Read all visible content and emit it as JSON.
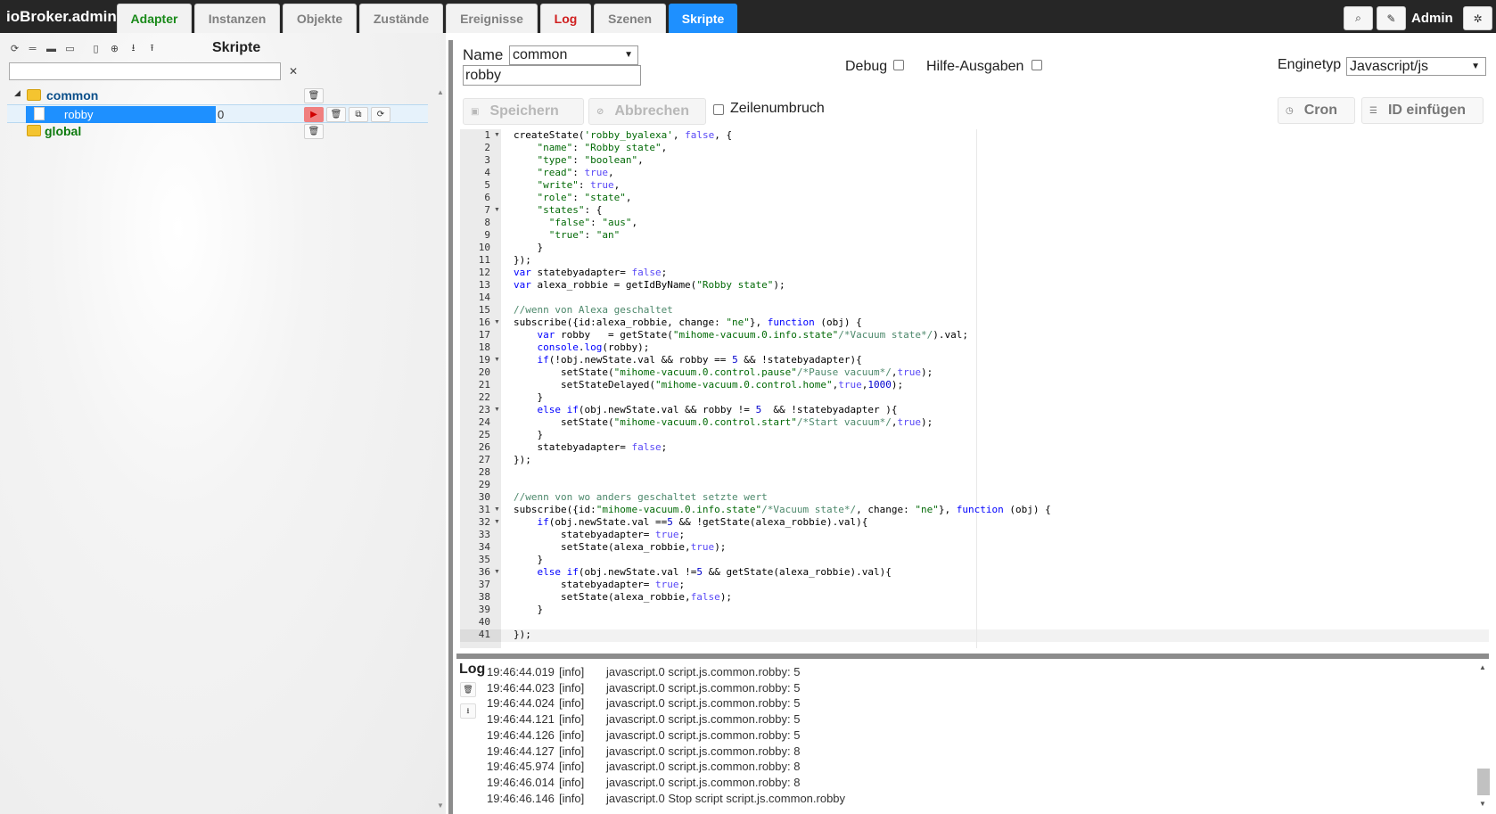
{
  "app": {
    "title": "ioBroker.admin"
  },
  "tabs": [
    {
      "label": "Adapter"
    },
    {
      "label": "Instanzen"
    },
    {
      "label": "Objekte"
    },
    {
      "label": "Zustände"
    },
    {
      "label": "Ereignisse"
    },
    {
      "label": "Log"
    },
    {
      "label": "Szenen"
    },
    {
      "label": "Skripte"
    }
  ],
  "header": {
    "user": "Admin",
    "icons": [
      "search-icon",
      "edit-icon",
      "settings-icon"
    ]
  },
  "sidebar": {
    "title": "Skripte",
    "filter_value": "",
    "toolbar_icons": [
      "refresh-icon",
      "collapse-icon",
      "folder-icon",
      "folder-open-icon",
      "new-script-icon",
      "add-folder-icon",
      "export-icon",
      "import-icon"
    ],
    "tree": {
      "folders": [
        {
          "label": "common",
          "expanded": true
        },
        {
          "label": "global",
          "expanded": false
        }
      ],
      "scripts": [
        {
          "label": "robby",
          "count": "0",
          "status": "stopped"
        }
      ]
    }
  },
  "editor_header": {
    "name_label": "Name",
    "folder_select_value": "common",
    "name_value": "robby",
    "debug_label": "Debug",
    "debug_checked": false,
    "help_label": "Hilfe-Ausgaben",
    "help_checked": false,
    "engine_label": "Enginetyp",
    "engine_value": "Javascript/js"
  },
  "editor_toolbar": {
    "save_label": "Speichern",
    "cancel_label": "Abbrechen",
    "wrap_label": "Zeilenumbruch",
    "wrap_checked": false,
    "cron_label": "Cron",
    "insert_id_label": "ID einfügen"
  },
  "code": {
    "active_line": 41,
    "fold_lines": [
      1,
      7,
      16,
      19,
      23,
      31,
      32,
      36
    ],
    "lines": [
      [
        [
          "createState(",
          ""
        ],
        [
          "'robby_byalexa'",
          "str"
        ],
        [
          ", ",
          ""
        ],
        [
          "false",
          "bool"
        ],
        [
          ", {",
          ""
        ]
      ],
      [
        [
          "    ",
          ""
        ],
        [
          "\"name\"",
          "str"
        ],
        [
          ": ",
          ""
        ],
        [
          "\"Robby state\"",
          "str"
        ],
        [
          ",",
          ""
        ]
      ],
      [
        [
          "    ",
          ""
        ],
        [
          "\"type\"",
          "str"
        ],
        [
          ": ",
          ""
        ],
        [
          "\"boolean\"",
          "str"
        ],
        [
          ",",
          ""
        ]
      ],
      [
        [
          "    ",
          ""
        ],
        [
          "\"read\"",
          "str"
        ],
        [
          ": ",
          ""
        ],
        [
          "true",
          "bool"
        ],
        [
          ",",
          ""
        ]
      ],
      [
        [
          "    ",
          ""
        ],
        [
          "\"write\"",
          "str"
        ],
        [
          ": ",
          ""
        ],
        [
          "true",
          "bool"
        ],
        [
          ",",
          ""
        ]
      ],
      [
        [
          "    ",
          ""
        ],
        [
          "\"role\"",
          "str"
        ],
        [
          ": ",
          ""
        ],
        [
          "\"state\"",
          "str"
        ],
        [
          ",",
          ""
        ]
      ],
      [
        [
          "    ",
          ""
        ],
        [
          "\"states\"",
          "str"
        ],
        [
          ": {",
          ""
        ]
      ],
      [
        [
          "      ",
          ""
        ],
        [
          "\"false\"",
          "str"
        ],
        [
          ": ",
          ""
        ],
        [
          "\"aus\"",
          "str"
        ],
        [
          ",",
          ""
        ]
      ],
      [
        [
          "      ",
          ""
        ],
        [
          "\"true\"",
          "str"
        ],
        [
          ": ",
          ""
        ],
        [
          "\"an\"",
          "str"
        ]
      ],
      [
        [
          "    }",
          ""
        ]
      ],
      [
        [
          "});",
          ""
        ]
      ],
      [
        [
          "var",
          "kw"
        ],
        [
          " statebyadapter= ",
          ""
        ],
        [
          "false",
          "bool"
        ],
        [
          ";",
          ""
        ]
      ],
      [
        [
          "var",
          "kw"
        ],
        [
          " alexa_robbie = getIdByName(",
          ""
        ],
        [
          "\"Robby state\"",
          "str"
        ],
        [
          ");",
          ""
        ]
      ],
      [
        [
          "",
          ""
        ]
      ],
      [
        [
          "//wenn von Alexa geschaltet",
          "cm"
        ]
      ],
      [
        [
          "subscribe({id:alexa_robbie, change: ",
          ""
        ],
        [
          "\"ne\"",
          "str"
        ],
        [
          "}, ",
          ""
        ],
        [
          "function",
          "kw"
        ],
        [
          " (obj) {",
          ""
        ]
      ],
      [
        [
          "    ",
          ""
        ],
        [
          "var",
          "kw"
        ],
        [
          " robby   = getState(",
          ""
        ],
        [
          "\"mihome-vacuum.0.info.state\"",
          "str"
        ],
        [
          "/*Vacuum state*/",
          "cm"
        ],
        [
          ").val;",
          ""
        ]
      ],
      [
        [
          "    ",
          ""
        ],
        [
          "console",
          "kw"
        ],
        [
          ".",
          ""
        ],
        [
          "log",
          "kw"
        ],
        [
          "(robby);",
          ""
        ]
      ],
      [
        [
          "    ",
          ""
        ],
        [
          "if",
          "kw"
        ],
        [
          "(!obj.newState.val && robby == ",
          ""
        ],
        [
          "5",
          "num"
        ],
        [
          " && !statebyadapter){",
          ""
        ]
      ],
      [
        [
          "        setState(",
          ""
        ],
        [
          "\"mihome-vacuum.0.control.pause\"",
          "str"
        ],
        [
          "/*Pause vacuum*/",
          "cm"
        ],
        [
          ",",
          ""
        ],
        [
          "true",
          "bool"
        ],
        [
          ");",
          ""
        ]
      ],
      [
        [
          "        setStateDelayed(",
          ""
        ],
        [
          "\"mihome-vacuum.0.control.home\"",
          "str"
        ],
        [
          ",",
          ""
        ],
        [
          "true",
          "bool"
        ],
        [
          ",",
          ""
        ],
        [
          "1000",
          "num"
        ],
        [
          ");",
          ""
        ]
      ],
      [
        [
          "    }",
          ""
        ]
      ],
      [
        [
          "    ",
          ""
        ],
        [
          "else",
          "kw"
        ],
        [
          " ",
          ""
        ],
        [
          "if",
          "kw"
        ],
        [
          "(obj.newState.val && robby != ",
          ""
        ],
        [
          "5",
          "num"
        ],
        [
          "  && !statebyadapter ){",
          ""
        ]
      ],
      [
        [
          "        setState(",
          ""
        ],
        [
          "\"mihome-vacuum.0.control.start\"",
          "str"
        ],
        [
          "/*Start vacuum*/",
          "cm"
        ],
        [
          ",",
          ""
        ],
        [
          "true",
          "bool"
        ],
        [
          ");",
          ""
        ]
      ],
      [
        [
          "    }",
          ""
        ]
      ],
      [
        [
          "    statebyadapter= ",
          ""
        ],
        [
          "false",
          "bool"
        ],
        [
          ";",
          ""
        ]
      ],
      [
        [
          "});",
          ""
        ]
      ],
      [
        [
          "",
          ""
        ]
      ],
      [
        [
          "",
          ""
        ]
      ],
      [
        [
          "//wenn von wo anders geschaltet setzte wert",
          "cm"
        ]
      ],
      [
        [
          "subscribe({id:",
          ""
        ],
        [
          "\"mihome-vacuum.0.info.state\"",
          "str"
        ],
        [
          "/*Vacuum state*/",
          "cm"
        ],
        [
          ", change: ",
          ""
        ],
        [
          "\"ne\"",
          "str"
        ],
        [
          "}, ",
          ""
        ],
        [
          "function",
          "kw"
        ],
        [
          " (obj) {",
          ""
        ]
      ],
      [
        [
          "    ",
          ""
        ],
        [
          "if",
          "kw"
        ],
        [
          "(obj.newState.val ==",
          ""
        ],
        [
          "5",
          "num"
        ],
        [
          " && !getState(alexa_robbie).val){",
          ""
        ]
      ],
      [
        [
          "        statebyadapter= ",
          ""
        ],
        [
          "true",
          "bool"
        ],
        [
          ";",
          ""
        ]
      ],
      [
        [
          "        setState(alexa_robbie,",
          ""
        ],
        [
          "true",
          "bool"
        ],
        [
          ");",
          ""
        ]
      ],
      [
        [
          "    }",
          ""
        ]
      ],
      [
        [
          "    ",
          ""
        ],
        [
          "else",
          "kw"
        ],
        [
          " ",
          ""
        ],
        [
          "if",
          "kw"
        ],
        [
          "(obj.newState.val !=",
          ""
        ],
        [
          "5",
          "num"
        ],
        [
          " && getState(alexa_robbie).val){",
          ""
        ]
      ],
      [
        [
          "        statebyadapter= ",
          ""
        ],
        [
          "true",
          "bool"
        ],
        [
          ";",
          ""
        ]
      ],
      [
        [
          "        setState(alexa_robbie,",
          ""
        ],
        [
          "false",
          "bool"
        ],
        [
          ");",
          ""
        ]
      ],
      [
        [
          "    }",
          ""
        ]
      ],
      [
        [
          "",
          ""
        ]
      ],
      [
        [
          "});",
          ""
        ]
      ]
    ]
  },
  "log": {
    "title": "Log",
    "tool_icons": [
      "trash-icon",
      "download-icon"
    ],
    "entries": [
      {
        "time": "19:46:44.019",
        "level": "[info]",
        "message": "javascript.0 script.js.common.robby: 5"
      },
      {
        "time": "19:46:44.023",
        "level": "[info]",
        "message": "javascript.0 script.js.common.robby: 5"
      },
      {
        "time": "19:46:44.024",
        "level": "[info]",
        "message": "javascript.0 script.js.common.robby: 5"
      },
      {
        "time": "19:46:44.121",
        "level": "[info]",
        "message": "javascript.0 script.js.common.robby: 5"
      },
      {
        "time": "19:46:44.126",
        "level": "[info]",
        "message": "javascript.0 script.js.common.robby: 5"
      },
      {
        "time": "19:46:44.127",
        "level": "[info]",
        "message": "javascript.0 script.js.common.robby: 8"
      },
      {
        "time": "19:46:45.974",
        "level": "[info]",
        "message": "javascript.0 script.js.common.robby: 8"
      },
      {
        "time": "19:46:46.014",
        "level": "[info]",
        "message": "javascript.0 script.js.common.robby: 8"
      },
      {
        "time": "19:46:46.146",
        "level": "[info]",
        "message": "javascript.0 Stop script script.js.common.robby"
      }
    ]
  },
  "colors": {
    "accent": "#1e90ff",
    "topbar": "#262626",
    "tab_green": "#1a8a1a",
    "tab_red": "#d02020",
    "folder_label": "#0d7a0d"
  }
}
